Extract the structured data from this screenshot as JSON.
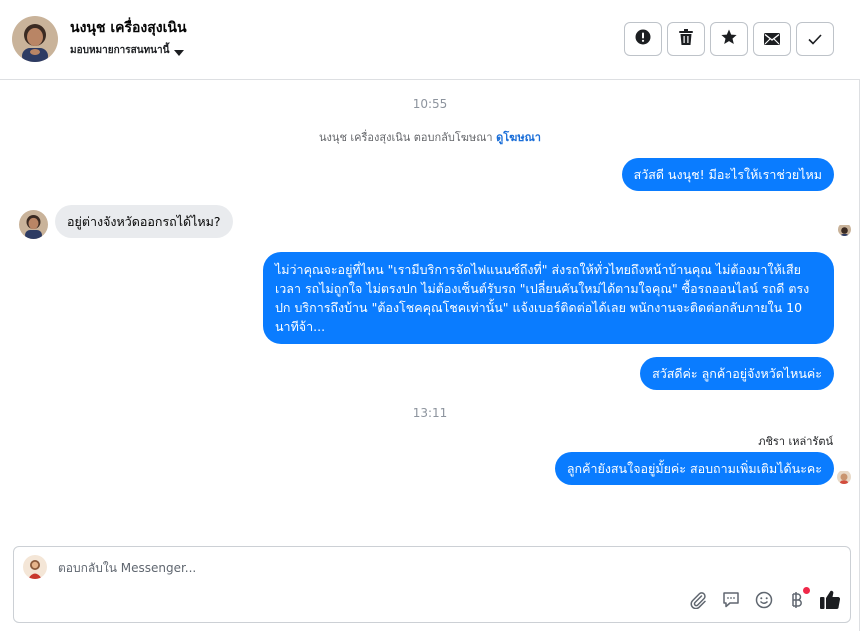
{
  "header": {
    "contact_name": "นงนุช เครื่องสุงเนิน",
    "assign_label": "มอบหมายการสนทนานี้",
    "actions": [
      {
        "name": "report-button",
        "icon": "exclamation-circle-icon"
      },
      {
        "name": "delete-button",
        "icon": "trash-icon"
      },
      {
        "name": "star-button",
        "icon": "star-icon"
      },
      {
        "name": "mark-unread-button",
        "icon": "envelope-icon"
      },
      {
        "name": "mark-done-button",
        "icon": "checkmark-icon"
      }
    ]
  },
  "conversation": {
    "timestamp_1": "10:55",
    "context_text": "นงนุช เครื่องสุงเนิน ตอบกลับโฆษณา",
    "context_link": "ดูโฆษณา",
    "msg_out_1": "สวัสดี นงนุช! มีอะไรให้เราช่วยไหม",
    "msg_in_1": "อยู่ต่างจังหวัดออกรถได้ไหม?",
    "msg_out_2": "ไม่ว่าคุณจะอยู่ที่ไหน \"เรามีบริการจัดไฟแนนซ์ถึงที่\"  ส่งรถให้ทั่วไทยถึงหน้าบ้านคุณ ไม่ต้องมาให้เสียเวลา รถไม่ถูกใจ ไม่ตรงปก ไม่ต้องเซ็นต์รับรถ \"เปลี่ยนคันใหม่ได้ตามใจคุณ\" ซื้อรถออนไลน์ รถดี ตรงปก บริการถึงบ้าน \"ต้องโชคคุณโชคเท่านั้น\" แจ้งเบอร์ติดต่อได้เลย พนักงานจะติดต่อกลับภายใน 10 นาทีจ้า...",
    "msg_out_3": "สวัสดีค่ะ ลูกค้าอยู่จังหวัดไหนค่ะ",
    "timestamp_2": "13:11",
    "sender_name": "ภชิรา เหล่ารัตน์",
    "msg_out_4": "ลูกค้ายังสนใจอยู่มั้ยค่ะ สอบถามเพิ่มเติมได้นะคะ"
  },
  "composer": {
    "placeholder": "ตอบกลับใน Messenger...",
    "tools": [
      "paperclip-icon",
      "saved-replies-icon",
      "emoji-icon",
      "baht-payment-icon",
      "thumbs-up-icon"
    ]
  },
  "colors": {
    "accent": "#0a7cff",
    "link": "#1a6ed8",
    "incoming_bubble": "#e9ebee",
    "notification": "#f02849"
  }
}
